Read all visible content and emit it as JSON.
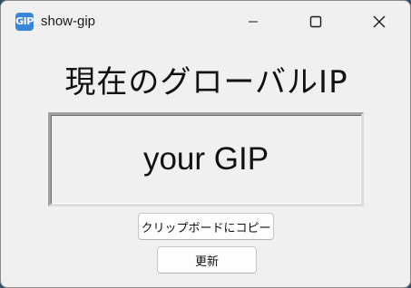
{
  "window": {
    "title": "show-gip",
    "icon_label": "GIP",
    "icon_color": "#3a86d6"
  },
  "caption_buttons": {
    "minimize": "minimize-icon",
    "maximize": "maximize-icon",
    "close": "close-icon"
  },
  "main": {
    "heading": "現在のグローバルIP",
    "ip_value": "your GIP",
    "copy_label": "クリップボードにコピー",
    "refresh_label": "更新"
  }
}
